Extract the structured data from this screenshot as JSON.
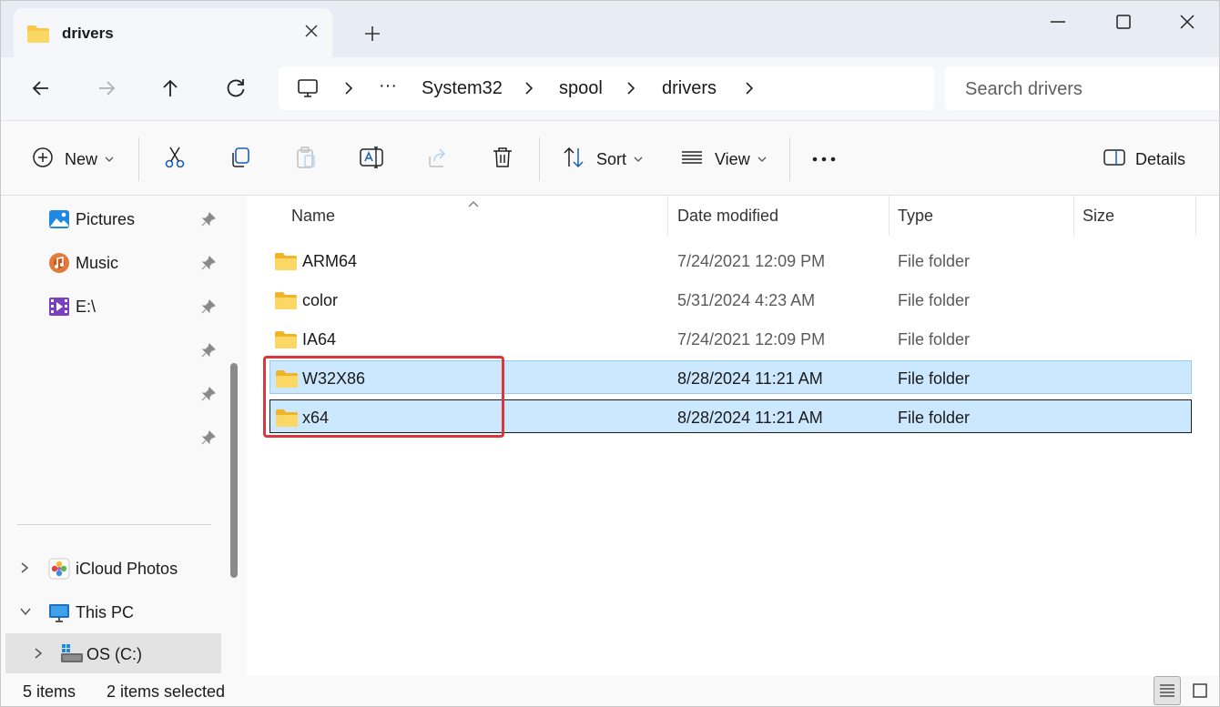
{
  "window": {
    "tab_title": "drivers",
    "new_tab_symbol": "+",
    "close_symbol": "✕"
  },
  "address": {
    "ellipsis": "···",
    "crumbs": [
      "System32",
      "spool",
      "drivers"
    ],
    "search_placeholder": "Search drivers"
  },
  "commands": {
    "new_label": "New",
    "sort_label": "Sort",
    "view_label": "View",
    "details_label": "Details"
  },
  "sidebar": {
    "items": [
      {
        "label": "Pictures"
      },
      {
        "label": "Music"
      },
      {
        "label": "E:\\"
      }
    ],
    "tree": [
      {
        "label": "iCloud Photos"
      },
      {
        "label": "This PC"
      },
      {
        "label": "OS (C:)"
      }
    ]
  },
  "columns": {
    "name": "Name",
    "date": "Date modified",
    "type": "Type",
    "size": "Size"
  },
  "files": [
    {
      "name": "ARM64",
      "date": "7/24/2021 12:09 PM",
      "type": "File folder",
      "selected": false
    },
    {
      "name": "color",
      "date": "5/31/2024 4:23 AM",
      "type": "File folder",
      "selected": false
    },
    {
      "name": "IA64",
      "date": "7/24/2021 12:09 PM",
      "type": "File folder",
      "selected": false
    },
    {
      "name": "W32X86",
      "date": "8/28/2024 11:21 AM",
      "type": "File folder",
      "selected": true
    },
    {
      "name": "x64",
      "date": "8/28/2024 11:21 AM",
      "type": "File folder",
      "selected": true
    }
  ],
  "status": {
    "item_count": "5 items",
    "selection": "2 items selected"
  },
  "colors": {
    "selection_fill": "#cce8ff",
    "highlight_box": "#d9363e",
    "folder": "#f8c947"
  }
}
